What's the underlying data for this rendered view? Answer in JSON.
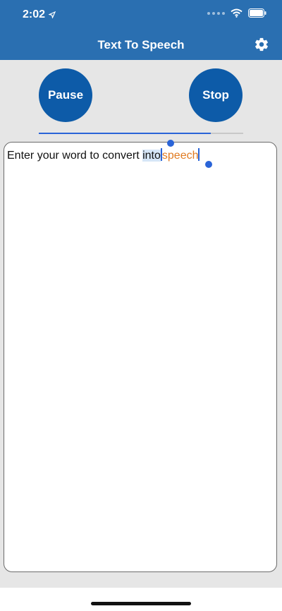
{
  "status_bar": {
    "time": "2:02"
  },
  "header": {
    "title": "Text To Speech"
  },
  "controls": {
    "pause_label": "Pause",
    "stop_label": "Stop",
    "progress": 0.84
  },
  "editor": {
    "text_before": "Enter your word to convert ",
    "text_selected": "into",
    "text_spoken": "speech"
  },
  "colors": {
    "header": "#2a6fb1",
    "button": "#0d5ba8",
    "accent": "#2a64d8",
    "spoken_word": "#e07b22"
  },
  "icons": {
    "settings": "gear-icon",
    "location": "location-arrow-icon",
    "wifi": "wifi-icon",
    "battery": "battery-icon"
  }
}
